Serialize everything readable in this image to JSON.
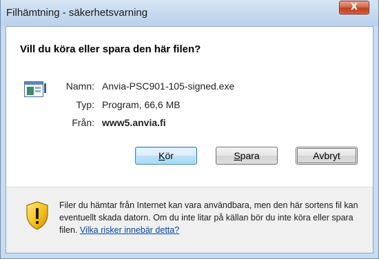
{
  "window": {
    "title": "Filhämtning - säkerhetsvarning",
    "close_label": "X"
  },
  "dialog": {
    "question": "Vill du köra eller spara den här filen?",
    "file": {
      "icon": "program-file-icon",
      "name_label": "Namn:",
      "name_value": "Anvia-PSC901-105-signed.exe",
      "type_label": "Typ:",
      "type_value": "Program, 66,6 MB",
      "from_label": "Från:",
      "from_value": "www5.anvia.fi"
    },
    "buttons": {
      "run": {
        "prefix": "",
        "underlined": "K",
        "suffix": "ör"
      },
      "save": {
        "prefix": "",
        "underlined": "S",
        "suffix": "para"
      },
      "cancel": {
        "label": "Avbryt"
      }
    }
  },
  "footer": {
    "icon": "security-shield-warning-icon",
    "warning_text": "Filer du hämtar från Internet kan vara användbara, men den här sortens fil kan eventuellt skada datorn. Om du inte litar på källan bör du inte köra eller spara filen. ",
    "link_text": "Vilka risker innebär detta?"
  },
  "colors": {
    "titlebar": "#c4d8ee",
    "close_button": "#c1401f",
    "link": "#0645ad",
    "footer_bg": "#f0f0f0"
  }
}
